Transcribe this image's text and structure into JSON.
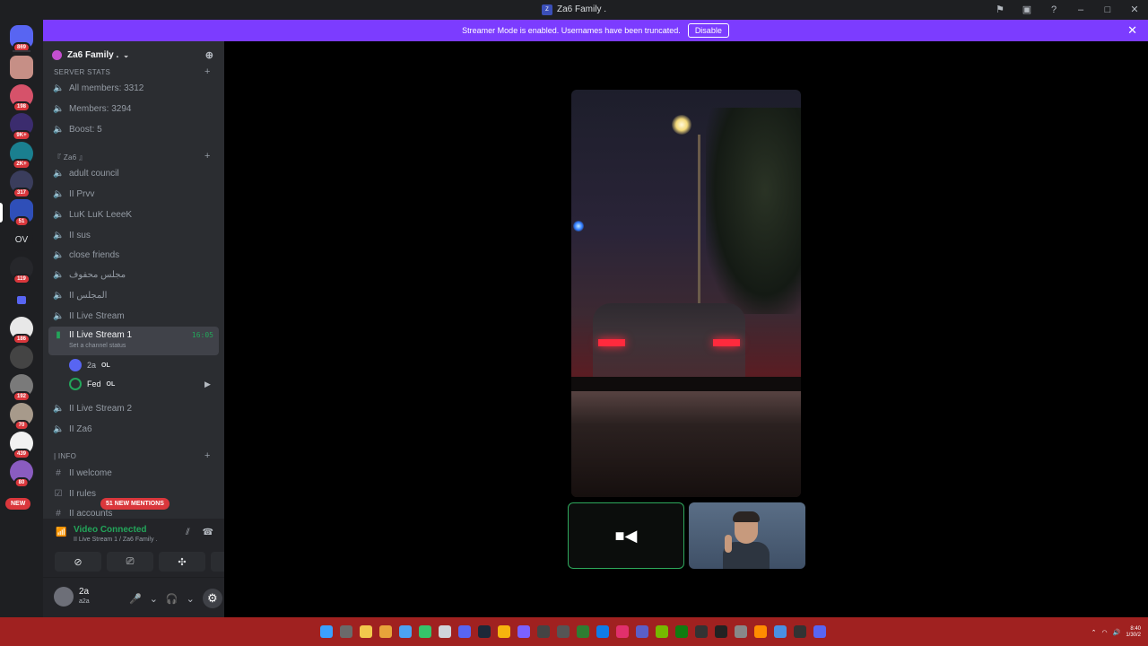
{
  "window": {
    "title": "Za6 Family .",
    "controls": [
      "flag-icon",
      "screen-icon",
      "help-icon",
      "minimize-icon",
      "maximize-icon",
      "close-icon"
    ]
  },
  "banner": {
    "message": "Streamer Mode is enabled. Usernames have been truncated.",
    "disable_label": "Disable"
  },
  "rail": {
    "home_badge": "869",
    "servers": [
      {
        "badge": ""
      },
      {
        "badge": "198"
      },
      {
        "badge": "9K+"
      },
      {
        "badge": "2K+"
      },
      {
        "badge": "317"
      },
      {
        "badge": "51"
      },
      {
        "label": "OV",
        "badge": ""
      },
      {
        "badge": "119"
      },
      {
        "badge": ""
      },
      {
        "badge": "186"
      },
      {
        "badge": ""
      },
      {
        "badge": "192"
      },
      {
        "badge": "70"
      },
      {
        "badge": "439"
      },
      {
        "badge": "80"
      }
    ],
    "new_label": "NEW"
  },
  "guild": {
    "name": "Za6 Family .",
    "categories": {
      "stats": "SERVER STATS",
      "za6": "『 Za6 』",
      "info": "| INFO"
    },
    "stats_channels": [
      "All members: 3312",
      "Members: 3294",
      "Boost: 5"
    ],
    "voice_channels": [
      "adult council",
      "II Prvv",
      "LuK LuK LeeeK",
      "II sus",
      "close friends",
      "مجلس محفوف",
      "II المجلس",
      "II Live Stream"
    ],
    "active_channel": {
      "name": "II Live Stream 1",
      "time": "16:05",
      "status": "Set a channel status"
    },
    "voice_users": [
      {
        "name": "2a",
        "tag": "OL"
      },
      {
        "name": "Fed",
        "tag": "OL"
      }
    ],
    "voice_channels_after": [
      "II Live Stream 2",
      "II Za6"
    ],
    "text_channels": [
      "II welcome",
      "II rules",
      "II accounts"
    ],
    "mentions": "51 NEW MENTIONS"
  },
  "voice_panel": {
    "title": "Video Connected",
    "subtitle": "II Live Stream 1 / Za6 Family ."
  },
  "user": {
    "name": "2a",
    "sub": "a2a"
  },
  "taskbar": {
    "time": "8:40",
    "date": "1/30/2"
  }
}
